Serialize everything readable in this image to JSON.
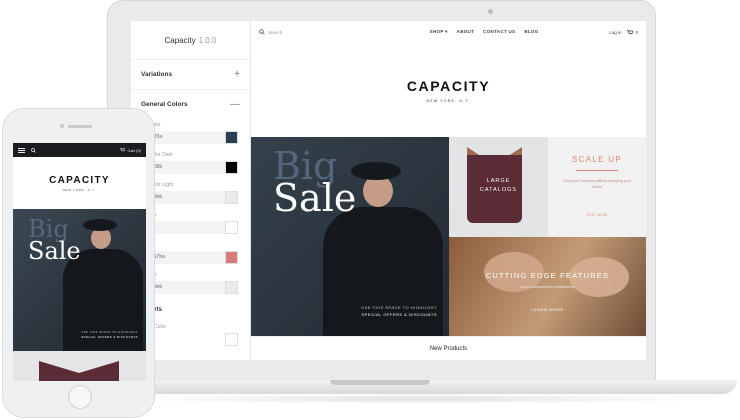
{
  "laptop": {
    "panel": {
      "title": "Capacity",
      "version": "1.0.0",
      "sections": [
        {
          "label": "Variations",
          "control": "+"
        },
        {
          "label": "General Colors",
          "control": "—"
        }
      ],
      "fields": [
        {
          "label": "y Color",
          "value": "f3f3a",
          "swatch": "#2c3e54"
        },
        {
          "label": "y Color Dark",
          "value": "505b",
          "swatch": "#000000"
        },
        {
          "label": "y Color Light",
          "value": "e9eb",
          "swatch": "#e9ebeb"
        },
        {
          "label": "Color",
          "value": "f",
          "swatch": "#ffffff"
        },
        {
          "label": "olor",
          "value": "a17ba",
          "swatch": "#d97a7a"
        },
        {
          "label": "Color",
          "value": "e9eb",
          "swatch": "#e9ebeb"
        }
      ],
      "subsection": "Alerts",
      "last_field": {
        "label": "uss Color",
        "swatch": "#ffffff"
      }
    },
    "site": {
      "search_placeholder": "Search",
      "nav": [
        "SHOP ▾",
        "ABOUT",
        "CONTACT US",
        "BLOG"
      ],
      "login": "Log in",
      "cart": "0",
      "logo": "CAPACITY",
      "logo_sub": "NEW YORK, N.Y.",
      "hero": {
        "big": "Big",
        "sale": "Sale",
        "caption1": "USE THIS SPACE TO HIGHLIGHT",
        "caption2": "SPECIAL OFFERS & DISCOUNTS"
      },
      "tile_catalogs": {
        "line1": "LARGE",
        "line2": "CATALOGS"
      },
      "tile_scale": {
        "title": "SCALE UP",
        "desc": "Grow your business without changing your theme",
        "more": "SEE NOW"
      },
      "tile_features": {
        "title": "CUTTING EDGE FEATURES",
        "subtitle": "A new standard in ecommerce",
        "cta": "LEARN MORE"
      },
      "new_products": "New Products"
    }
  },
  "phone": {
    "cart": "Cart (0)",
    "logo": "CAPACITY",
    "logo_sub": "NEW YORK, N.Y.",
    "hero": {
      "big": "Big",
      "sale": "Sale",
      "caption1": "USE THIS SPACE TO HIGHLIGHT",
      "caption2": "SPECIAL OFFERS & DISCOUNTS"
    }
  },
  "colors": {
    "accent": "#e08379",
    "dark": "#1a1c1f",
    "catalog": "#5b2c35"
  },
  "icons": [
    "search-icon",
    "cart-icon",
    "menu-icon",
    "plus-icon",
    "minus-icon"
  ]
}
